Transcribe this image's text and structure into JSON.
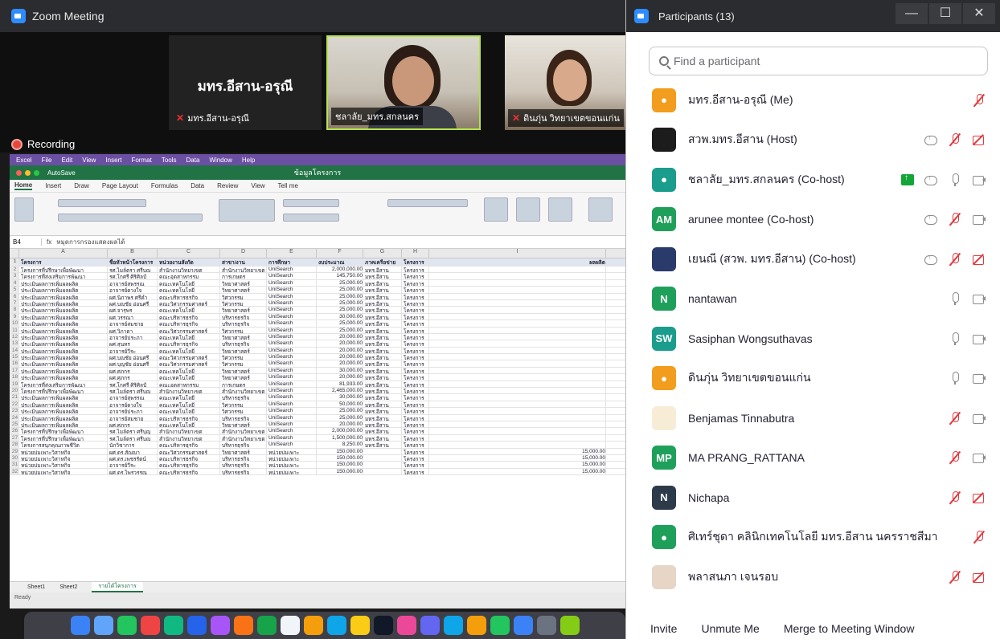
{
  "zoom": {
    "window_title": "Zoom Meeting",
    "tiles": [
      {
        "big_name": "มทร.อีสาน-อรุณี",
        "label": "มทร.อีสาน-อรุณี"
      },
      {
        "label": "ชลาลัย_มทร.สกลนคร"
      },
      {
        "label": "ดินภุ่น วิทยาเขตขอนแก่น"
      }
    ],
    "recording_label": "Recording"
  },
  "excel": {
    "menubar": [
      "Excel",
      "File",
      "Edit",
      "View",
      "Insert",
      "Format",
      "Tools",
      "Data",
      "Window",
      "Help"
    ],
    "doc_title": "ข้อมูลโครงการ",
    "autosave": "AutoSave",
    "tabs": [
      "Home",
      "Insert",
      "Draw",
      "Page Layout",
      "Formulas",
      "Data",
      "Review",
      "View",
      "Tell me"
    ],
    "cell_ref": "B4",
    "formula": "หมุดการกรองแสดงผลได้",
    "columns": [
      "A",
      "B",
      "C",
      "D",
      "E",
      "F",
      "G",
      "H",
      "I"
    ],
    "headers": [
      "โครงการ",
      "ชื่อหัวหน้าโครงการ",
      "หน่วยงานสังกัด",
      "สาขา/งาน",
      "การศึกษา",
      "งบประมาณ",
      "ภาคเครือข่าย",
      "โครงการ",
      "ผลผลิต"
    ],
    "rows": [
      [
        "โครงการที่ปรึกษาเพื่อพัฒนา",
        "รศ.ไมล์ตรา ศรีบุญ",
        "สำนักงานวิทยาเขต",
        "สำนักงานวิทยาเขต",
        "UniSearch",
        "2,000,000.00",
        "มทร.อีสาน",
        "โครงการ",
        ""
      ],
      [
        "โครงการที่ส่งเสริมการพัฒนา",
        "รศ.โกศรี ศิริศิลป์",
        "คณะอุตสาหกรรม",
        "การเกษตร",
        "UniSearch",
        "145,750.00",
        "มทร.อีสาน",
        "โครงการ",
        ""
      ],
      [
        "ประเมินผลการเพิ่มผลผลิต",
        "อาจารย์สุพรรณ",
        "คณะเทคโนโลยี",
        "วิทยาศาสตร์",
        "UniSearch",
        "25,000.00",
        "มทร.อีสาน",
        "โครงการ",
        ""
      ],
      [
        "ประเมินผลการเพิ่มผลผลิต",
        "อาจารย์ดวงใจ",
        "คณะเทคโนโลยี",
        "วิทยาศาสตร์",
        "UniSearch",
        "25,000.00",
        "มทร.อีสาน",
        "โครงการ",
        ""
      ],
      [
        "ประเมินผลการเพิ่มผลผลิต",
        "ผศ.นิภาพร ศรีคำ",
        "คณะบริหารธุรกิจ",
        "วิศวกรรม",
        "UniSearch",
        "25,000.00",
        "มทร.อีสาน",
        "โครงการ",
        ""
      ],
      [
        "ประเมินผลการเพิ่มผลผลิต",
        "ผศ.บุญชัย อ่อนศรี",
        "คณะวิศวกรรมศาสตร์",
        "วิศวกรรม",
        "UniSearch",
        "25,000.00",
        "มทร.อีสาน",
        "โครงการ",
        ""
      ],
      [
        "ประเมินผลการเพิ่มผลผลิต",
        "ผศ.จารุพร",
        "คณะเทคโนโลยี",
        "วิทยาศาสตร์",
        "UniSearch",
        "25,000.00",
        "มทร.อีสาน",
        "โครงการ",
        ""
      ],
      [
        "ประเมินผลการเพิ่มผลผลิต",
        "ผศ.วรรณา",
        "คณะบริหารธุรกิจ",
        "บริหารธุรกิจ",
        "UniSearch",
        "30,000.00",
        "มทร.อีสาน",
        "โครงการ",
        ""
      ],
      [
        "ประเมินผลการเพิ่มผลผลิต",
        "อาจารย์สมชาย",
        "คณะบริหารธุรกิจ",
        "บริหารธุรกิจ",
        "UniSearch",
        "25,000.00",
        "มทร.อีสาน",
        "โครงการ",
        ""
      ],
      [
        "ประเมินผลการเพิ่มผลผลิต",
        "ผศ.วิภาดา",
        "คณะวิศวกรรมศาสตร์",
        "วิศวกรรม",
        "UniSearch",
        "25,000.00",
        "มทร.อีสาน",
        "โครงการ",
        ""
      ],
      [
        "ประเมินผลการเพิ่มผลผลิต",
        "อาจารย์ประภา",
        "คณะเทคโนโลยี",
        "วิทยาศาสตร์",
        "UniSearch",
        "20,000.00",
        "มทร.อีสาน",
        "โครงการ",
        ""
      ],
      [
        "ประเมินผลการเพิ่มผลผลิต",
        "ผศ.สุนทร",
        "คณะบริหารธุรกิจ",
        "บริหารธุรกิจ",
        "UniSearch",
        "20,000.00",
        "มทร.อีสาน",
        "โครงการ",
        ""
      ],
      [
        "ประเมินผลการเพิ่มผลผลิต",
        "อาจารย์วีระ",
        "คณะเทคโนโลยี",
        "วิทยาศาสตร์",
        "UniSearch",
        "20,000.00",
        "มทร.อีสาน",
        "โครงการ",
        ""
      ],
      [
        "ประเมินผลการเพิ่มผลผลิต",
        "ผศ.บุญชัย อ่อนศรี",
        "คณะวิศวกรรมศาสตร์",
        "วิศวกรรม",
        "UniSearch",
        "20,000.00",
        "มทร.อีสาน",
        "โครงการ",
        ""
      ],
      [
        "ประเมินผลการเพิ่มผลผลิต",
        "ผศ.บุญชัย อ่อนศรี",
        "คณะวิศวกรรมศาสตร์",
        "วิศวกรรม",
        "UniSearch",
        "20,000.00",
        "มทร.อีสาน",
        "โครงการ",
        ""
      ],
      [
        "ประเมินผลการเพิ่มผลผลิต",
        "ผศ.ศุภกร",
        "คณะเทคโนโลยี",
        "วิทยาศาสตร์",
        "UniSearch",
        "30,000.00",
        "มทร.อีสาน",
        "โครงการ",
        ""
      ],
      [
        "ประเมินผลการเพิ่มผลผลิต",
        "ผศ.ศุภกร",
        "คณะเทคโนโลยี",
        "วิทยาศาสตร์",
        "UniSearch",
        "20,000.00",
        "มทร.อีสาน",
        "โครงการ",
        ""
      ],
      [
        "โครงการที่ส่งเสริมการพัฒนา",
        "รศ.โกศรี ศิริศิลป์",
        "คณะอุตสาหกรรม",
        "การเกษตร",
        "UniSearch",
        "81,933.00",
        "มทร.อีสาน",
        "โครงการ",
        ""
      ],
      [
        "โครงการที่ปรึกษาเพื่อพัฒนา",
        "รศ.ไมล์ตรา ศรีบุญ",
        "สำนักงานวิทยาเขต",
        "สำนักงานวิทยาเขต",
        "UniSearch",
        "2,465,000.00",
        "มทร.อีสาน",
        "โครงการ",
        ""
      ],
      [
        "ประเมินผลการเพิ่มผลผลิต",
        "อาจารย์สุพรรณ",
        "คณะเทคโนโลยี",
        "บริหารธุรกิจ",
        "UniSearch",
        "30,000.00",
        "มทร.อีสาน",
        "โครงการ",
        ""
      ],
      [
        "ประเมินผลการเพิ่มผลผลิต",
        "อาจารย์ดวงใจ",
        "คณะเทคโนโลยี",
        "วิศวกรรม",
        "UniSearch",
        "50,000.00",
        "มทร.อีสาน",
        "โครงการ",
        ""
      ],
      [
        "ประเมินผลการเพิ่มผลผลิต",
        "อาจารย์ประภา",
        "คณะเทคโนโลยี",
        "วิศวกรรม",
        "UniSearch",
        "25,000.00",
        "มทร.อีสาน",
        "โครงการ",
        ""
      ],
      [
        "ประเมินผลการเพิ่มผลผลิต",
        "อาจารย์สมชาย",
        "คณะบริหารธุรกิจ",
        "บริหารธุรกิจ",
        "UniSearch",
        "25,000.00",
        "มทร.อีสาน",
        "โครงการ",
        ""
      ],
      [
        "ประเมินผลการเพิ่มผลผลิต",
        "ผศ.ศุภกร",
        "คณะเทคโนโลยี",
        "วิทยาศาสตร์",
        "UniSearch",
        "20,000.00",
        "มทร.อีสาน",
        "โครงการ",
        ""
      ],
      [
        "โครงการที่ปรึกษาเพื่อพัฒนา",
        "รศ.ไมล์ตรา ศรีบุญ",
        "สำนักงานวิทยาเขต",
        "สำนักงานวิทยาเขต",
        "UniSearch",
        "2,000,000.00",
        "มทร.อีสาน",
        "โครงการ",
        ""
      ],
      [
        "โครงการที่ปรึกษาเพื่อพัฒนา",
        "รศ.ไมล์ตรา ศรีบุญ",
        "สำนักงานวิทยาเขต",
        "สำนักงานวิทยาเขต",
        "UniSearch",
        "1,500,000.00",
        "มทร.อีสาน",
        "โครงการ",
        ""
      ],
      [
        "โครงการสนุกคุณภาพชีวิต",
        "นักวิชาการ",
        "คณะบริหารธุรกิจ",
        "บริหารธุรกิจ",
        "UniSearch",
        "8,250.00",
        "มทร.อีสาน",
        "โครงการ",
        ""
      ],
      [
        "หน่วยบ่มเพาะวิสาหกิจ",
        "ผศ.ดร.สัญญา",
        "คณะวิศวกรรมศาสตร์",
        "วิทยาศาสตร์",
        "หน่วยบ่มเพาะ",
        "150,000.00",
        "",
        "โครงการ",
        "15,000.00"
      ],
      [
        "หน่วยบ่มเพาะวิสาหกิจ",
        "ผศ.ดร.เพชรรัตน์",
        "คณะบริหารธุรกิจ",
        "บริหารธุรกิจ",
        "หน่วยบ่มเพาะ",
        "150,000.00",
        "",
        "โครงการ",
        "15,000.00"
      ],
      [
        "หน่วยบ่มเพาะวิสาหกิจ",
        "อาจารย์วีระ",
        "คณะบริหารธุรกิจ",
        "บริหารธุรกิจ",
        "หน่วยบ่มเพาะ",
        "150,000.00",
        "",
        "โครงการ",
        "15,000.00"
      ],
      [
        "หน่วยบ่มเพาะวิสาหกิจ",
        "ผศ.ดร.ไพรวรรณ",
        "คณะบริหารธุรกิจ",
        "บริหารธุรกิจ",
        "หน่วยบ่มเพาะ",
        "150,000.00",
        "",
        "โครงการ",
        "15,000.00"
      ]
    ],
    "sheet_tabs": [
      "Sheet1",
      "Sheet2",
      "รายได้โครงการ"
    ],
    "status": "Ready"
  },
  "participants": {
    "title": "Participants (13)",
    "search_placeholder": "Find a participant",
    "list": [
      {
        "initial": "●",
        "color": "#f29d1d",
        "name": "มทร.อีสาน-อรุณี (Me)",
        "icons": [
          "mic-off"
        ]
      },
      {
        "initial": "",
        "color": "#1c1c1c",
        "name": "สวพ.มทร.อีสาน (Host)",
        "icons": [
          "cloud",
          "mic-off",
          "cam-off"
        ]
      },
      {
        "initial": "●",
        "color": "#1a9d8c",
        "name": "ชลาลัย_มทร.สกลนคร (Co-host)",
        "icons": [
          "share",
          "cloud",
          "mic-on",
          "cam-on"
        ]
      },
      {
        "initial": "AM",
        "color": "#1fa05a",
        "name": "arunee montee (Co-host)",
        "icons": [
          "cloud",
          "mic-off",
          "cam-on"
        ]
      },
      {
        "initial": "",
        "color": "#2a3a6a",
        "name": "เยนณี (สวพ. มทร.อีสาน) (Co-host)",
        "icons": [
          "cloud",
          "mic-off",
          "cam-off"
        ]
      },
      {
        "initial": "N",
        "color": "#1fa05a",
        "name": "nantawan",
        "icons": [
          "mic-on",
          "cam-on"
        ]
      },
      {
        "initial": "SW",
        "color": "#1a9d8c",
        "name": "Sasiphan Wongsuthavas",
        "icons": [
          "mic-on",
          "cam-on"
        ]
      },
      {
        "initial": "●",
        "color": "#f29d1d",
        "name": "ดินภุ่น วิทยาเขตขอนแก่น",
        "icons": [
          "mic-on",
          "cam-on"
        ]
      },
      {
        "initial": "",
        "color": "#f7ecd6",
        "name": "Benjamas Tinnabutra",
        "icons": [
          "mic-off",
          "cam-on"
        ]
      },
      {
        "initial": "MP",
        "color": "#1fa05a",
        "name": "MA PRANG_RATTANA",
        "icons": [
          "mic-off",
          "cam-on"
        ]
      },
      {
        "initial": "N",
        "color": "#2d3a4a",
        "name": "Nichapa",
        "icons": [
          "mic-off",
          "cam-off"
        ]
      },
      {
        "initial": "●",
        "color": "#1fa05a",
        "name": "ศิเทร์ชุดา คลินิกเทคโนโลยี มทร.อีสาน นครราชสีมา",
        "icons": [
          "mic-off"
        ]
      },
      {
        "initial": "",
        "color": "#e7d5c5",
        "name": "พลาสนภา เจนรอบ",
        "icons": [
          "mic-off",
          "cam-off"
        ]
      }
    ],
    "buttons": {
      "invite": "Invite",
      "unmute": "Unmute Me",
      "merge": "Merge to Meeting Window"
    }
  }
}
